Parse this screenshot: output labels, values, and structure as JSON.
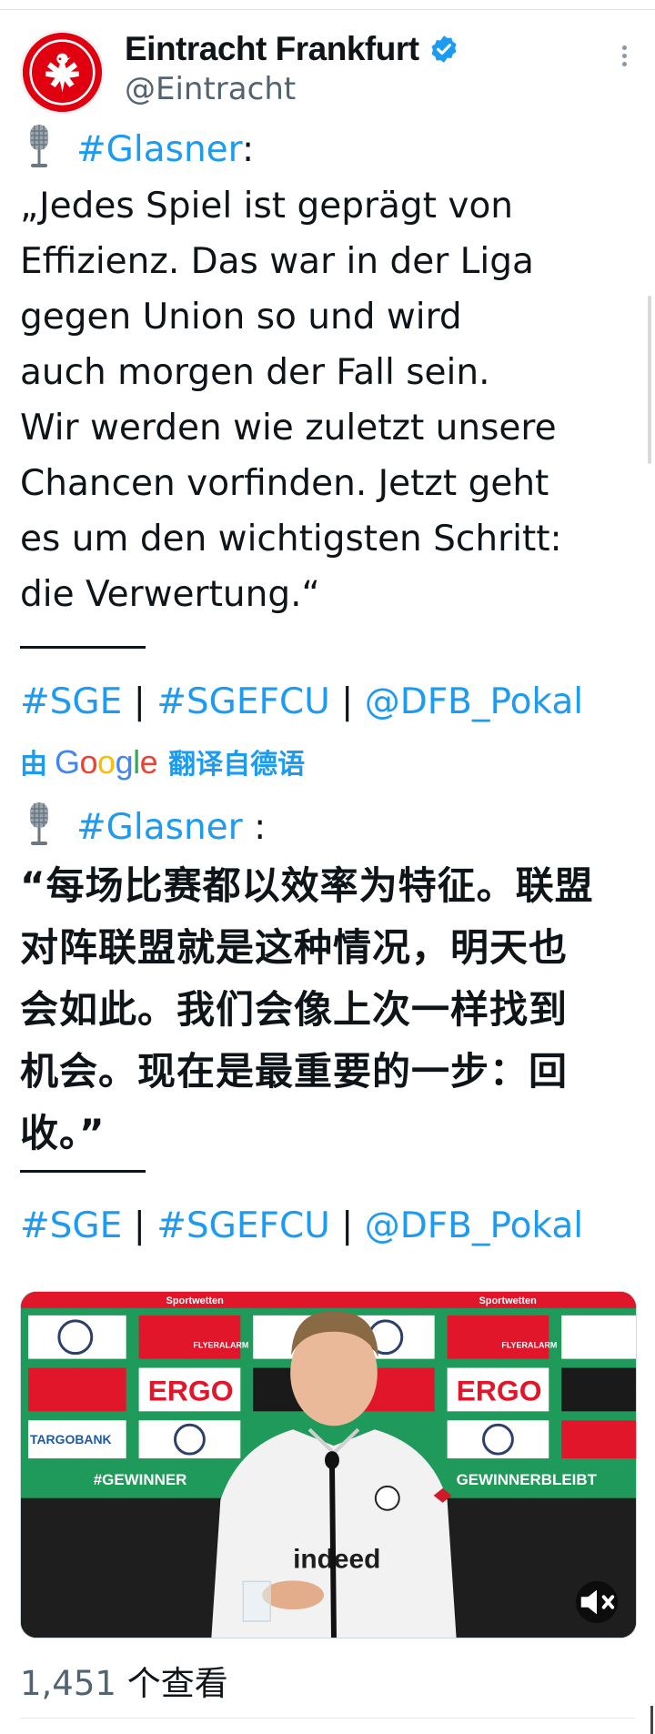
{
  "tweet": {
    "author": {
      "display_name": "Eintracht Frankfurt",
      "handle": "@Eintracht",
      "verified": true
    },
    "icons": {
      "avatar": "eintracht-eagle-crest",
      "verified": "verified-badge-icon",
      "more": "more-options-icon",
      "mic": "microphone-icon",
      "mute": "mute-icon"
    },
    "original": {
      "hashtag": "#Glasner",
      "colon": ":",
      "lines": [
        "„Jedes Spiel ist geprägt von",
        "Effizienz. Das war in der Liga",
        "gegen Union so und wird",
        "auch morgen der Fall sein.",
        "Wir werden wie zuletzt unsere",
        "Chancen vorfinden. Jetzt geht",
        "es um den wichtigsten Schritt:",
        "die Verwertung.“"
      ],
      "tags": [
        "#SGE",
        "#SGEFCU",
        "@DFB_Pokal"
      ],
      "separator": "|"
    },
    "translation_banner": {
      "prefix": "由",
      "provider": "Google",
      "suffix": "翻译自德语"
    },
    "translated": {
      "hashtag": "#Glasner",
      "colon": ":",
      "lines": [
        "“每场比赛都以效率为特征。联盟",
        "对阵联盟就是这种情况，明天也",
        "会如此。我们会像上次一样找到",
        "机会。现在是最重要的一步：回",
        "收。”"
      ],
      "tags": [
        "#SGE",
        "#SGEFCU",
        "@DFB_Pokal"
      ],
      "separator": "|"
    },
    "media": {
      "type": "video",
      "backdrop_words": [
        "ERGO",
        "TARGOBANK",
        "#GEWINNER",
        "GEWINNERBLEIBT",
        "Sportwetten",
        "FLYERALARM"
      ],
      "shirt_text": "indeed",
      "colors": {
        "backdrop_green": "#1f9a5a",
        "backdrop_red": "#e2162b",
        "accent_blue": "#1d9bf0"
      }
    },
    "views": {
      "count": "1,451",
      "label": "个查看"
    }
  }
}
